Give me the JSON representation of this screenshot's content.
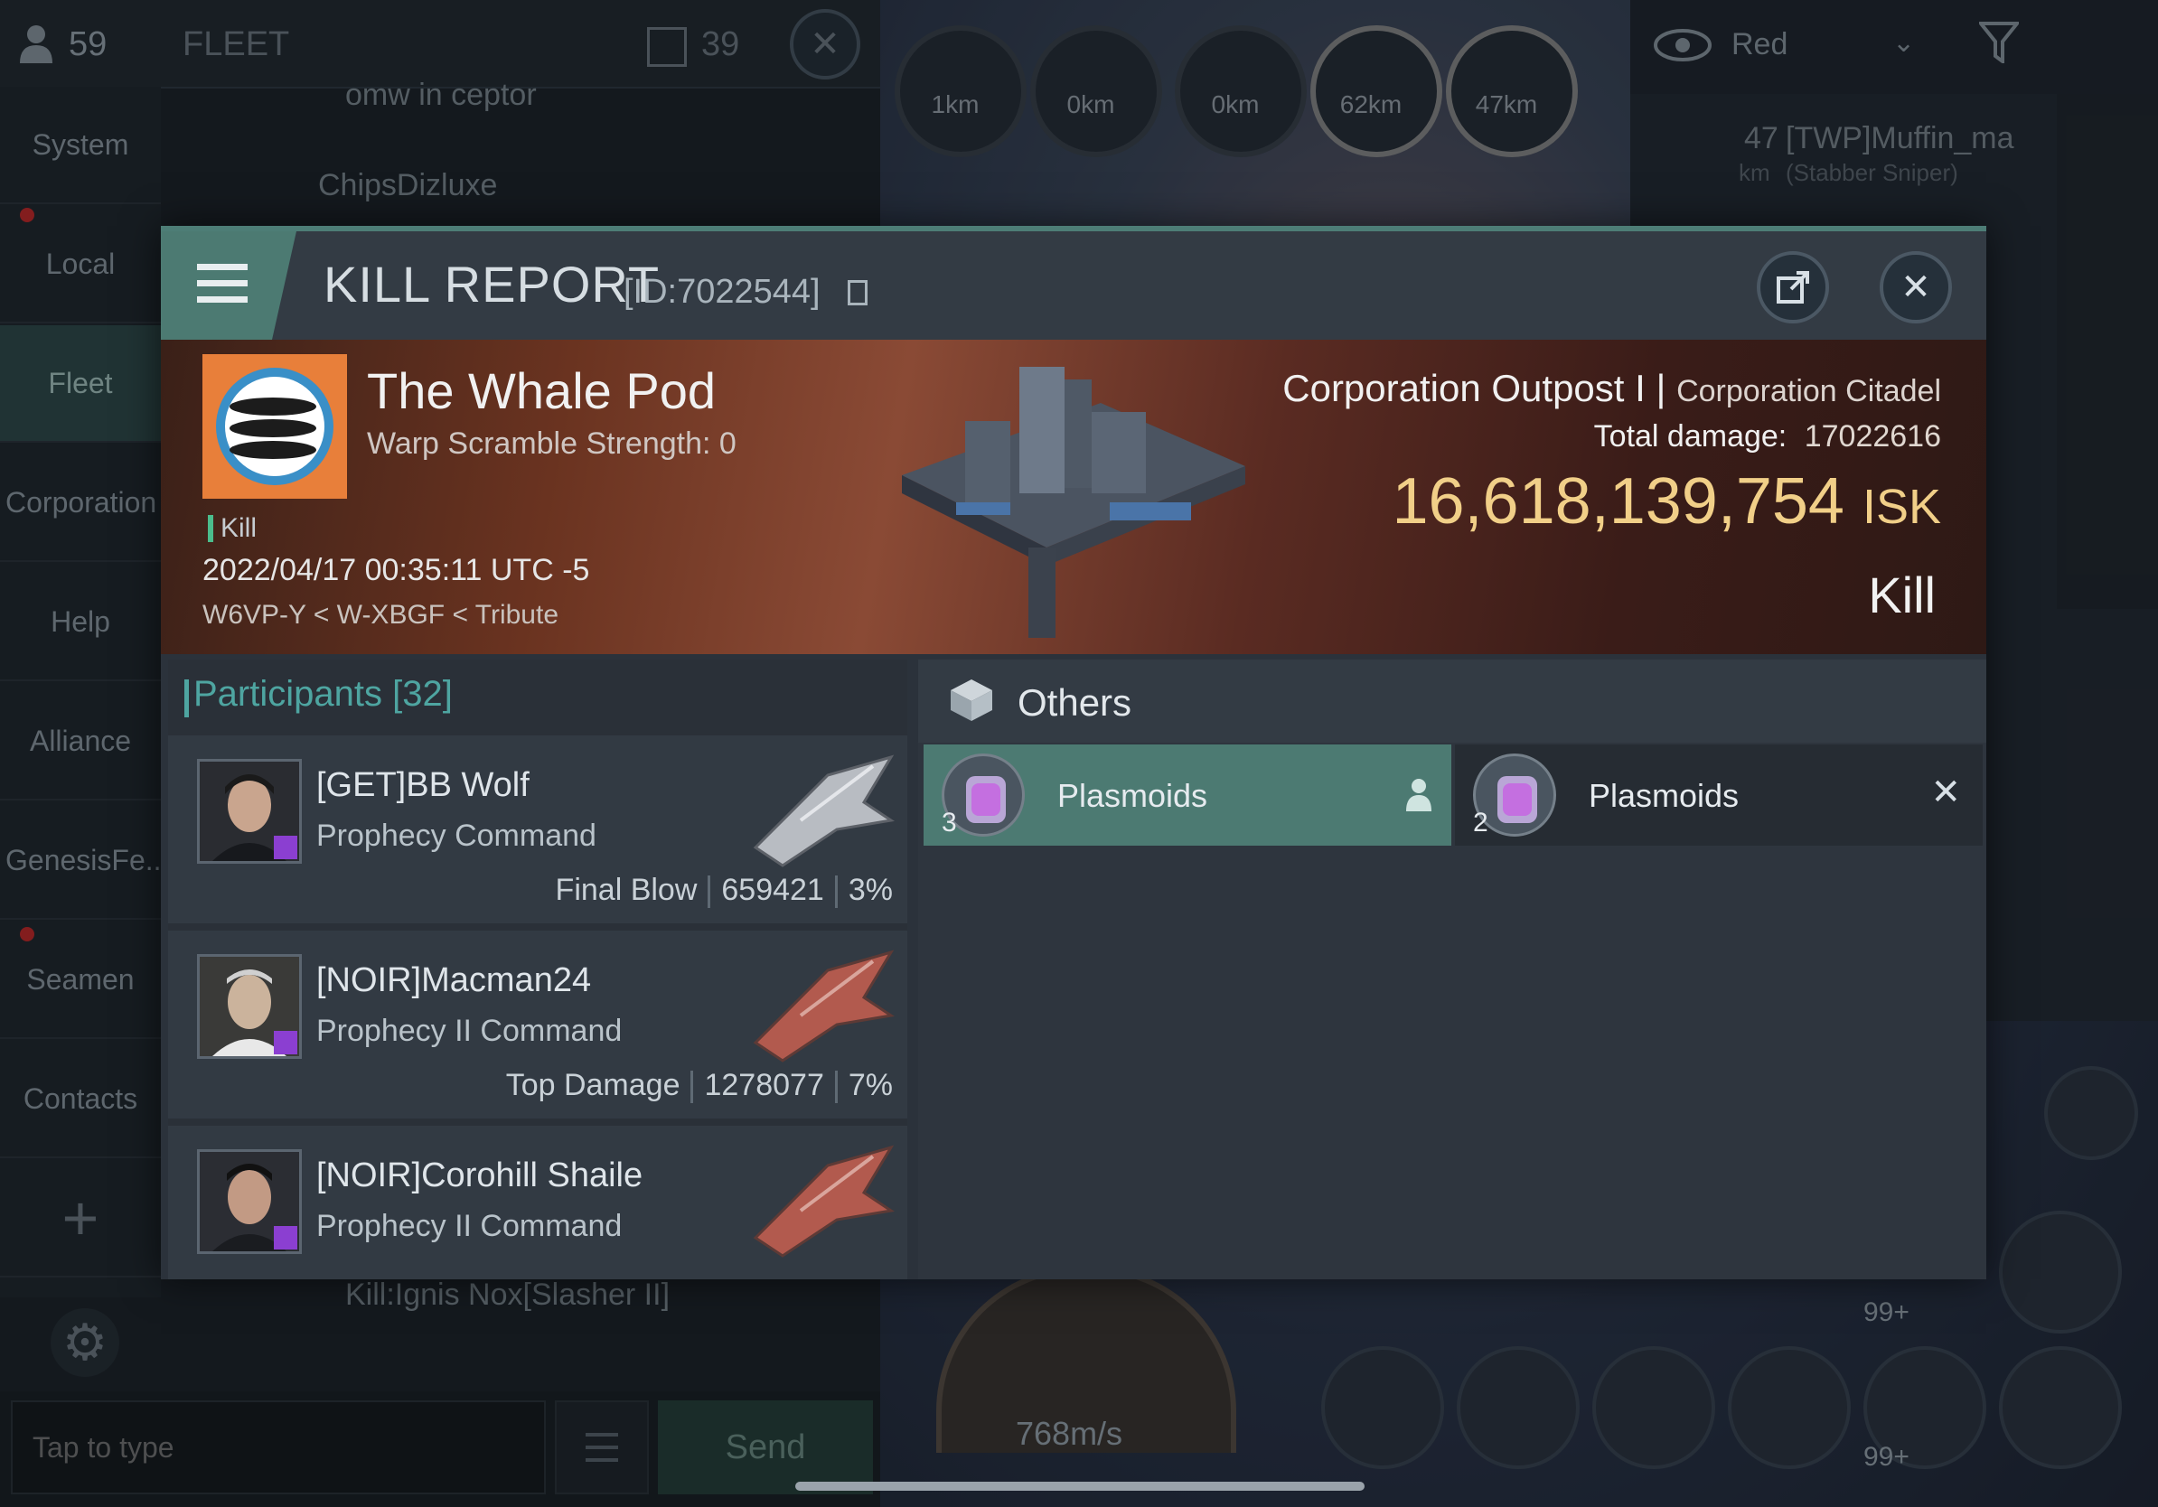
{
  "fleet_panel": {
    "member_count": "59",
    "title": "FLEET",
    "ship_count": "39",
    "nav": [
      "System",
      "Local",
      "Fleet",
      "Corporation",
      "Help",
      "Alliance",
      "GenesisFe..",
      "Seamen",
      "Contacts"
    ],
    "messages": [
      "omw in ceptor",
      "ChipsDizluxe",
      "Kill:Ignis Nox[Slasher II]"
    ],
    "chat_placeholder": "Tap to type",
    "send_label": "Send"
  },
  "space_hud": {
    "overview_filter": "Red",
    "targets": [
      {
        "dist": "1km"
      },
      {
        "dist": "0km"
      },
      {
        "dist": "0km"
      },
      {
        "dist": "62km"
      },
      {
        "dist": "47km"
      }
    ],
    "overview_row": {
      "dist": "47",
      "unit": "km",
      "name": "[TWP]Muffin_ma",
      "ship": "(Stabber Sniper)"
    },
    "speed": "768m/s",
    "module_badges": [
      "99+",
      "99+"
    ]
  },
  "kill_report": {
    "title": "KILL REPORT",
    "id": "[ID:7022544]",
    "victim": {
      "name": "The Whale Pod",
      "warp_scramble": "Warp Scramble Strength: 0",
      "tag": "Kill",
      "datetime": "2022/04/17 00:35:11 UTC -5",
      "location": "W6VP-Y < W-XBGF < Tribute",
      "ship_name": "Corporation Outpost I",
      "ship_class": "Corporation Citadel",
      "total_damage_label": "Total damage:",
      "total_damage": "17022616",
      "isk_value": "16,618,139,754",
      "isk_unit": "ISK",
      "result": "Kill"
    },
    "participants": {
      "label": "Participants",
      "count": "[32]",
      "items": [
        {
          "name": "[GET]BB Wolf",
          "ship": "Prophecy Command",
          "role": "Final Blow",
          "damage": "659421",
          "pct": "3%",
          "hull_color": "#b8bcc2"
        },
        {
          "name": "[NOIR]Macman24",
          "ship": "Prophecy II Command",
          "role": "Top Damage",
          "damage": "1278077",
          "pct": "7%",
          "hull_color": "#b25a4e"
        },
        {
          "name": "[NOIR]Corohill Shaile",
          "ship": "Prophecy II Command",
          "role": "",
          "damage": "",
          "pct": "",
          "hull_color": "#b25a4e"
        }
      ]
    },
    "others": {
      "title": "Others",
      "items": [
        {
          "name": "Plasmoids",
          "qty": "3",
          "state": "selected",
          "action_icon": "person-icon"
        },
        {
          "name": "Plasmoids",
          "qty": "2",
          "state": "normal",
          "action_icon": "close-icon"
        }
      ]
    }
  },
  "colors": {
    "accent_teal": "#4ea5a1",
    "isk_gold": "#f1cf88",
    "selected_item": "#4c7a72",
    "corp_badge": "#8b3fd1"
  }
}
